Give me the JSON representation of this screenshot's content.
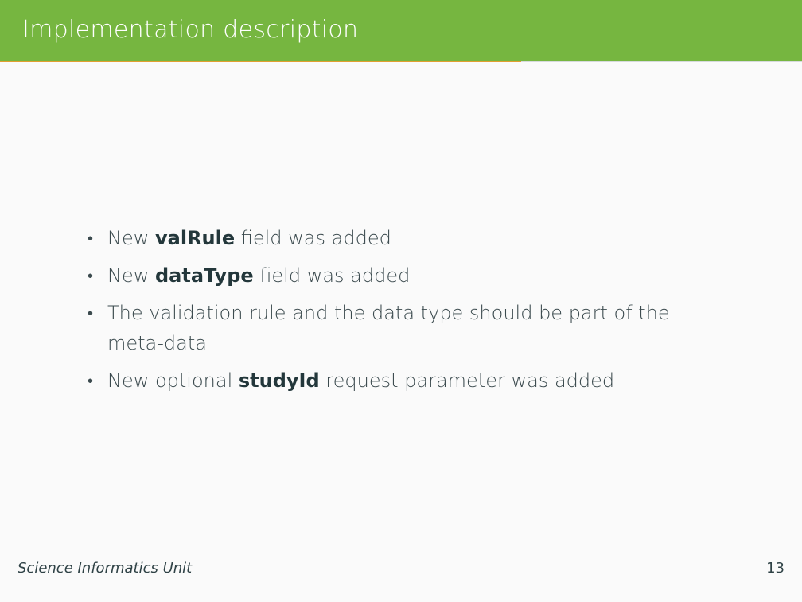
{
  "slide": {
    "title": "Implementation description",
    "progress": 0.65,
    "bullets": [
      {
        "pre": "New ",
        "em": "valRule",
        "post": " field was added"
      },
      {
        "pre": "New ",
        "em": "dataType",
        "post": " field was added"
      },
      {
        "pre": "The validation rule and the data type should be part of the meta-data",
        "em": "",
        "post": ""
      },
      {
        "pre": "New optional ",
        "em": "studyId",
        "post": " request parameter was added"
      }
    ],
    "bullet_symbol": "•"
  },
  "footer": {
    "text": "Science Informatics Unit",
    "page_number": "13"
  },
  "colors": {
    "header_bg": "#76b640",
    "progress": "#e0a030",
    "background": "#fafafa",
    "text": "#23373b"
  }
}
